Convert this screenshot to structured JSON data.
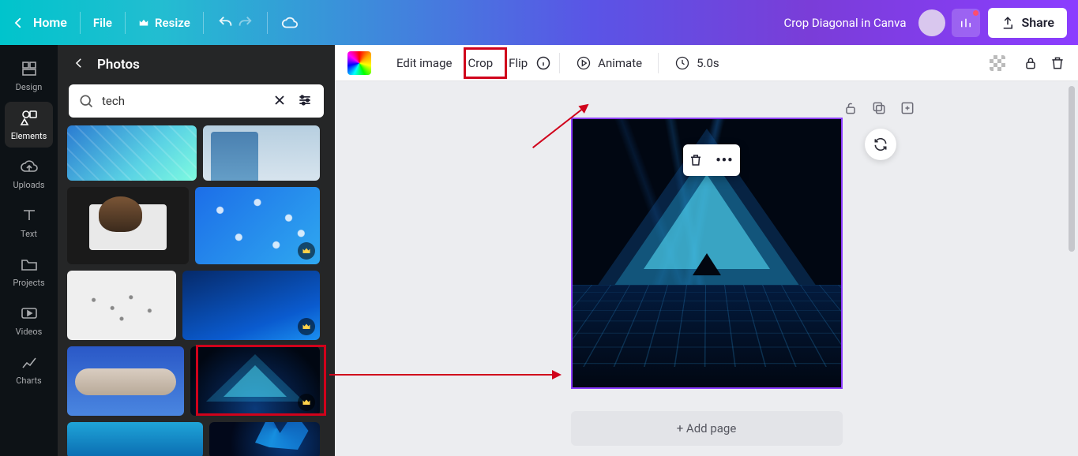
{
  "topbar": {
    "home": "Home",
    "file": "File",
    "resize": "Resize",
    "doc_title": "Crop Diagonal in Canva",
    "share": "Share"
  },
  "rail": {
    "design": "Design",
    "elements": "Elements",
    "uploads": "Uploads",
    "text": "Text",
    "projects": "Projects",
    "videos": "Videos",
    "charts": "Charts"
  },
  "side": {
    "title": "Photos",
    "search_value": "tech"
  },
  "toolbar": {
    "edit_image": "Edit image",
    "crop": "Crop",
    "flip": "Flip",
    "animate": "Animate",
    "timing": "5.0s"
  },
  "canvas": {
    "add_page": "+ Add page"
  }
}
